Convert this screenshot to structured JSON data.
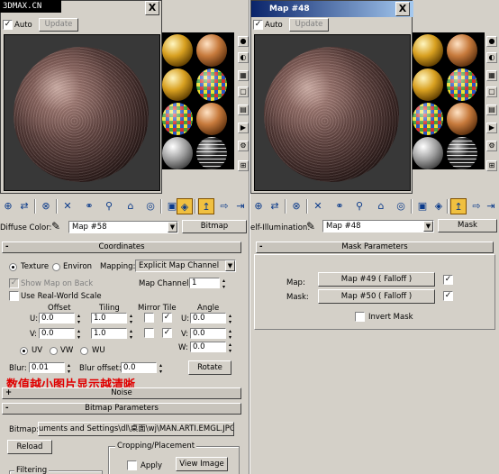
{
  "watermark": "3DMAX.CN",
  "left": {
    "preview": {
      "auto_label": "Auto",
      "auto_checked": true,
      "update_label": "Update",
      "close_glyph": "X"
    },
    "toolbar_icons": [
      "get-material-icon",
      "put-to-scene-icon",
      "assign-material-icon",
      "reset-map-icon",
      "make-unique-icon",
      "put-to-library-icon",
      "material-id-icon",
      "show-map-icon",
      "show-end-result-icon",
      "go-to-parent-icon",
      "go-forward-icon"
    ],
    "slot_label": "Diffuse Color:",
    "map_name": "Map #58",
    "map_type": "Bitmap",
    "coordinates": {
      "title": "Coordinates",
      "collapse": "-",
      "texture_label": "Texture",
      "environ_label": "Environ",
      "mapping_label": "Mapping:",
      "mapping_value": "Explicit Map Channel",
      "show_map_on_back": "Show Map on Back",
      "map_channel_label": "Map Channel:",
      "map_channel_value": "1",
      "use_real_world": "Use Real-World Scale",
      "offset_label": "Offset",
      "tiling_label": "Tiling",
      "mirror_tile_label": "Mirror Tile",
      "angle_label": "Angle",
      "u_label": "U:",
      "v_label": "V:",
      "w_label": "W:",
      "u_offset": "0.0",
      "v_offset": "0.0",
      "u_tiling": "1.0",
      "v_tiling": "1.0",
      "u_angle": "0.0",
      "v_angle": "0.0",
      "w_angle": "0.0",
      "uv_label": "UV",
      "vw_label": "VW",
      "wu_label": "WU",
      "blur_label": "Blur:",
      "blur_value": "0.01",
      "blur_offset_label": "Blur offset:",
      "blur_offset_value": "0.0",
      "rotate_label": "Rotate"
    },
    "annotation": "数值越小图片显示越清晰",
    "noise": {
      "title": "Noise",
      "expand": "+"
    },
    "bitmap_params": {
      "title": "Bitmap Parameters",
      "collapse": "-",
      "bitmap_label": "Bitmap:",
      "bitmap_path": "uments and Settings\\dl\\桌面\\wj\\MAN.ARTI.EMGL.JPG",
      "reload_label": "Reload",
      "cropping_label": "Cropping/Placement",
      "apply_label": "Apply",
      "view_image_label": "View Image",
      "filtering_label": "Filtering"
    }
  },
  "right": {
    "title": "Map #48",
    "preview": {
      "auto_label": "Auto",
      "auto_checked": true,
      "update_label": "Update",
      "close_glyph": "X"
    },
    "slot_label": "elf-Illumination:",
    "map_name": "Map #48",
    "map_type": "Mask",
    "mask_params": {
      "title": "Mask Parameters",
      "collapse": "-",
      "map_label": "Map:",
      "map_button": "Map #49  ( Falloff )",
      "mask_label": "Mask:",
      "mask_button": "Map #50  ( Falloff )",
      "invert_label": "Invert Mask"
    }
  },
  "colors": {
    "annotation_red": "#e00000",
    "highlight_yellow": "#f0c040",
    "titlebar_blue": "#0a246a"
  }
}
